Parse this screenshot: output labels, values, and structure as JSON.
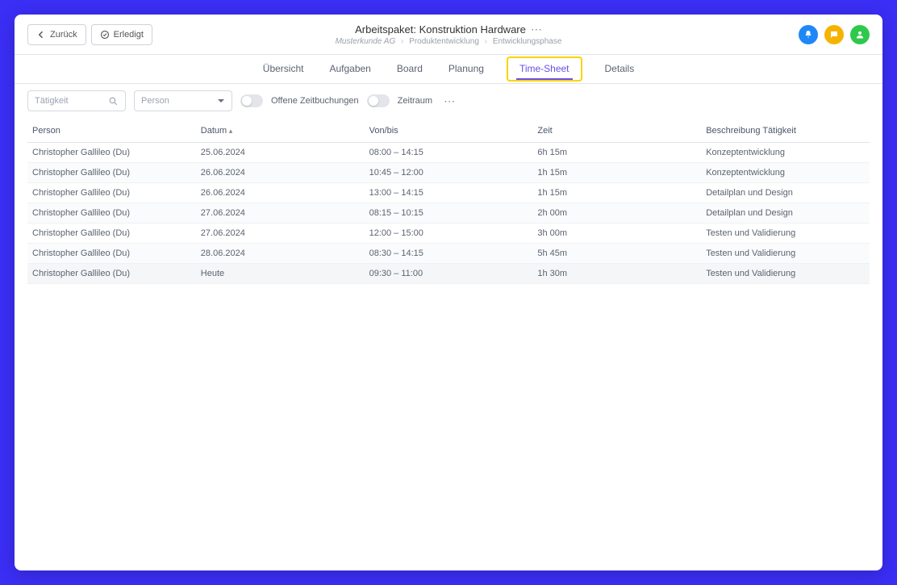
{
  "topbar": {
    "back_label": "Zurück",
    "done_label": "Erledigt",
    "title": "Arbeitspaket: Konstruktion Hardware",
    "breadcrumb": {
      "a": "Musterkunde AG",
      "b": "Produktentwicklung",
      "c": "Entwicklungsphase"
    }
  },
  "tabs": {
    "overview": "Übersicht",
    "tasks": "Aufgaben",
    "board": "Board",
    "planning": "Planung",
    "timesheet": "Time-Sheet",
    "details": "Details"
  },
  "filters": {
    "activity_placeholder": "Tätigkeit",
    "person_placeholder": "Person",
    "open_bookings_label": "Offene Zeitbuchungen",
    "period_label": "Zeitraum"
  },
  "table": {
    "headers": {
      "person": "Person",
      "date": "Datum",
      "range": "Von/bis",
      "time": "Zeit",
      "desc": "Beschreibung Tätigkeit"
    },
    "rows": [
      {
        "person": "Christopher Gallileo (Du)",
        "date": "25.06.2024",
        "range": "08:00 – 14:15",
        "time": "6h 15m",
        "desc": "Konzeptentwicklung"
      },
      {
        "person": "Christopher Gallileo (Du)",
        "date": "26.06.2024",
        "range": "10:45 – 12:00",
        "time": "1h 15m",
        "desc": "Konzeptentwicklung"
      },
      {
        "person": "Christopher Gallileo (Du)",
        "date": "26.06.2024",
        "range": "13:00 – 14:15",
        "time": "1h 15m",
        "desc": "Detailplan und Design"
      },
      {
        "person": "Christopher Gallileo (Du)",
        "date": "27.06.2024",
        "range": "08:15 – 10:15",
        "time": "2h 00m",
        "desc": "Detailplan und Design"
      },
      {
        "person": "Christopher Gallileo (Du)",
        "date": "27.06.2024",
        "range": "12:00 – 15:00",
        "time": "3h 00m",
        "desc": "Testen und Validierung"
      },
      {
        "person": "Christopher Gallileo (Du)",
        "date": "28.06.2024",
        "range": "08:30 – 14:15",
        "time": "5h 45m",
        "desc": "Testen und Validierung"
      },
      {
        "person": "Christopher Gallileo (Du)",
        "date": "Heute",
        "range": "09:30 – 11:00",
        "time": "1h 30m",
        "desc": "Testen und Validierung"
      }
    ]
  }
}
